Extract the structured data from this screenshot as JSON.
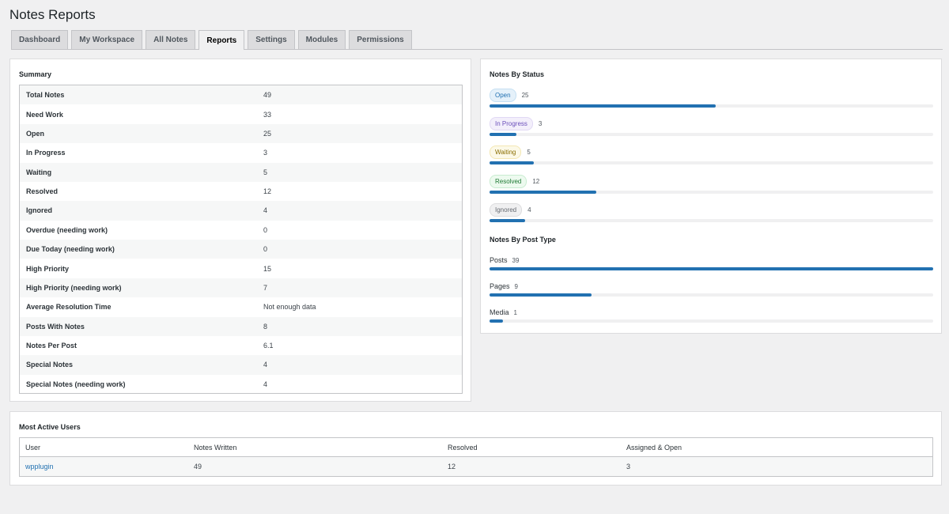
{
  "page_title": "Notes Reports",
  "tabs": [
    {
      "label": "Dashboard"
    },
    {
      "label": "My Workspace"
    },
    {
      "label": "All Notes"
    },
    {
      "label": "Reports"
    },
    {
      "label": "Settings"
    },
    {
      "label": "Modules"
    },
    {
      "label": "Permissions"
    }
  ],
  "active_tab": "Reports",
  "summary": {
    "title": "Summary",
    "rows": [
      {
        "label": "Total Notes",
        "value": "49"
      },
      {
        "label": "Need Work",
        "value": "33"
      },
      {
        "label": "Open",
        "value": "25"
      },
      {
        "label": "In Progress",
        "value": "3"
      },
      {
        "label": "Waiting",
        "value": "5"
      },
      {
        "label": "Resolved",
        "value": "12"
      },
      {
        "label": "Ignored",
        "value": "4"
      },
      {
        "label": "Overdue (needing work)",
        "value": "0"
      },
      {
        "label": "Due Today (needing work)",
        "value": "0"
      },
      {
        "label": "High Priority",
        "value": "15"
      },
      {
        "label": "High Priority (needing work)",
        "value": "7"
      },
      {
        "label": "Average Resolution Time",
        "value": "Not enough data"
      },
      {
        "label": "Posts With Notes",
        "value": "8"
      },
      {
        "label": "Notes Per Post",
        "value": "6.1"
      },
      {
        "label": "Special Notes",
        "value": "4"
      },
      {
        "label": "Special Notes (needing work)",
        "value": "4"
      }
    ]
  },
  "by_status": {
    "title": "Notes By Status",
    "items": [
      {
        "label": "Open",
        "count": "25",
        "fraction": 0.51,
        "style": "open"
      },
      {
        "label": "In Progress",
        "count": "3",
        "fraction": 0.06,
        "style": "progress"
      },
      {
        "label": "Waiting",
        "count": "5",
        "fraction": 0.1,
        "style": "waiting"
      },
      {
        "label": "Resolved",
        "count": "12",
        "fraction": 0.24,
        "style": "resolved"
      },
      {
        "label": "Ignored",
        "count": "4",
        "fraction": 0.08,
        "style": "ignored"
      }
    ]
  },
  "by_post_type": {
    "title": "Notes By Post Type",
    "items": [
      {
        "label": "Posts",
        "count": "39",
        "fraction": 1.0
      },
      {
        "label": "Pages",
        "count": "9",
        "fraction": 0.23
      },
      {
        "label": "Media",
        "count": "1",
        "fraction": 0.03
      }
    ]
  },
  "active_users": {
    "title": "Most Active Users",
    "columns": [
      "User",
      "Notes Written",
      "Resolved",
      "Assigned & Open"
    ],
    "rows": [
      {
        "user": "wpplugin",
        "notes_written": "49",
        "resolved": "12",
        "assigned_open": "3"
      }
    ]
  },
  "colors": {
    "accent": "#2271b1",
    "background": "#f0f0f1"
  }
}
